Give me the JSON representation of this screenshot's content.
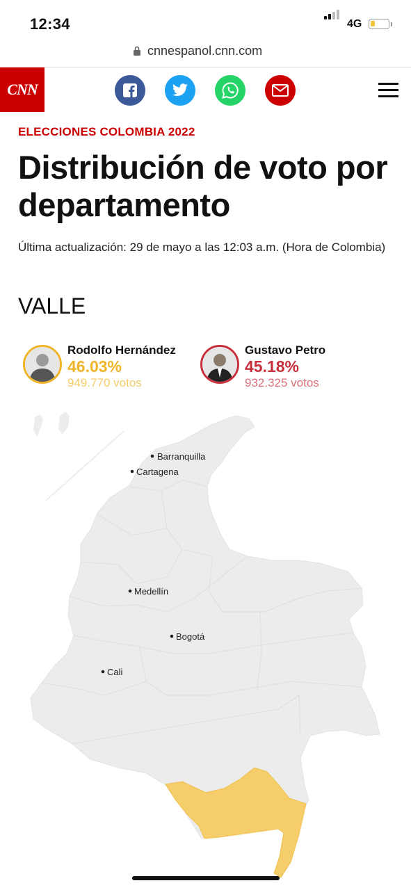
{
  "status_bar": {
    "time": "12:34",
    "network": "4G"
  },
  "browser": {
    "url": "cnnespanol.cnn.com"
  },
  "header": {
    "logo_text": "CNN",
    "share_buttons": [
      {
        "name": "facebook",
        "icon": "facebook-icon",
        "color": "#3b5998"
      },
      {
        "name": "twitter",
        "icon": "twitter-icon",
        "color": "#1da1f2"
      },
      {
        "name": "whatsapp",
        "icon": "whatsapp-icon",
        "color": "#25d366"
      },
      {
        "name": "email",
        "icon": "mail-icon",
        "color": "#cc0000"
      }
    ]
  },
  "article": {
    "kicker": "ELECCIONES COLOMBIA 2022",
    "title": "Distribución de voto por departamento",
    "updated": "Última actualización: 29 de mayo a las 12:03 a.m. (Hora de Colombia)",
    "department": "VALLE"
  },
  "candidates": [
    {
      "name": "Rodolfo Hernández",
      "percent": "46.03%",
      "votes": "949.770 votos",
      "color": "#f0b429",
      "votes_color": "#f5cd6a"
    },
    {
      "name": "Gustavo Petro",
      "percent": "45.18%",
      "votes": "932.325 votos",
      "color": "#c9303c",
      "votes_color": "#d9707a"
    }
  ],
  "map": {
    "cities": [
      "Barranquilla",
      "Cartagena",
      "Medellín",
      "Bogotá",
      "Cali"
    ],
    "highlighted_region_color": "#f5cd6a",
    "base_color": "#ececec"
  }
}
